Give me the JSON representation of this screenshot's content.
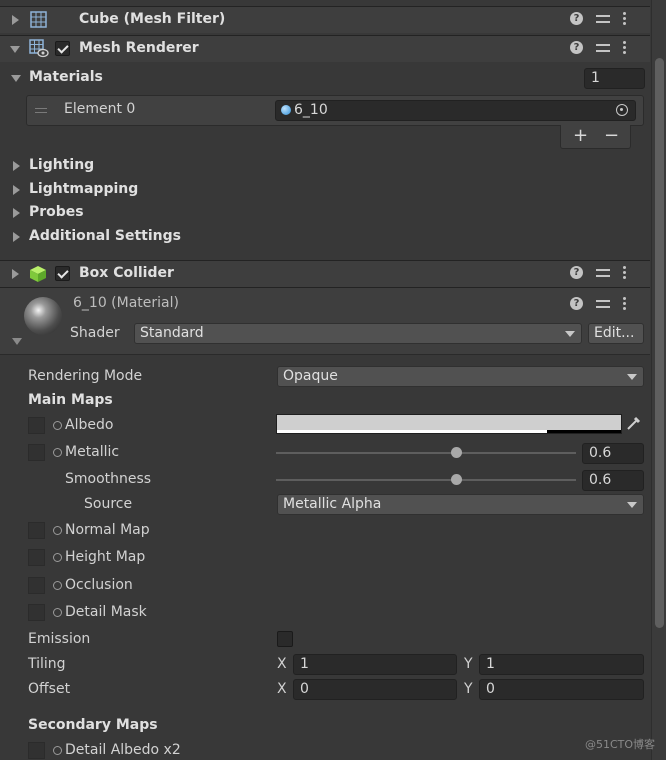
{
  "components": {
    "mesh_filter": {
      "title": "Cube (Mesh Filter)"
    },
    "mesh_renderer": {
      "title": "Mesh Renderer"
    },
    "box_collider": {
      "title": "Box Collider"
    }
  },
  "materials": {
    "label": "Materials",
    "size": "1",
    "element_label": "Element 0",
    "element_value": "6_10",
    "add": "+",
    "remove": "−"
  },
  "sections": [
    "Lighting",
    "Lightmapping",
    "Probes",
    "Additional Settings"
  ],
  "material": {
    "title": "6_10 (Material)",
    "shader_label": "Shader",
    "shader_value": "Standard",
    "edit_button": "Edit..."
  },
  "props": {
    "rendering_mode_label": "Rendering Mode",
    "rendering_mode_value": "Opaque",
    "main_maps": "Main Maps",
    "albedo": "Albedo",
    "metallic": "Metallic",
    "metallic_value": "0.6",
    "smoothness": "Smoothness",
    "smoothness_value": "0.6",
    "source": "Source",
    "source_value": "Metallic Alpha",
    "normal_map": "Normal Map",
    "height_map": "Height Map",
    "occlusion": "Occlusion",
    "detail_mask": "Detail Mask",
    "emission": "Emission",
    "tiling": "Tiling",
    "tiling_x": "1",
    "tiling_y": "1",
    "offset": "Offset",
    "offset_x": "0",
    "offset_y": "0",
    "x_label": "X",
    "y_label": "Y",
    "secondary_maps": "Secondary Maps",
    "detail_albedo": "Detail Albedo x2"
  },
  "slider_fractions": {
    "metallic": 0.6,
    "smoothness": 0.6
  },
  "watermark": "@51CTO博客",
  "help_glyph": "?"
}
